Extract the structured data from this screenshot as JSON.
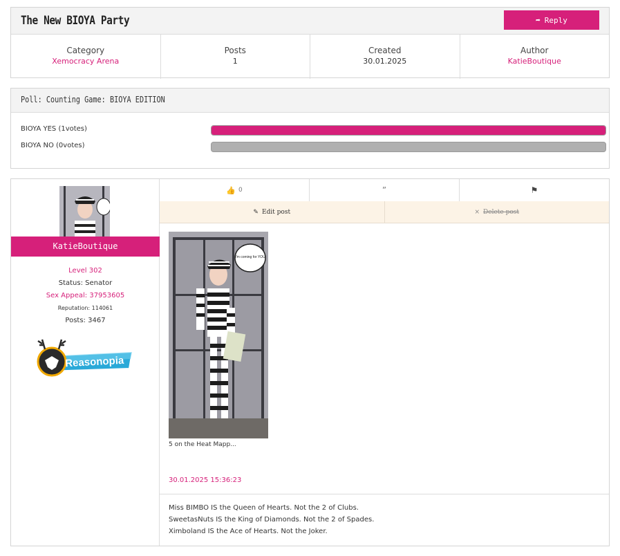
{
  "topic": {
    "title": "The New BIOYA Party",
    "reply_label": "Reply"
  },
  "meta": [
    {
      "label": "Category",
      "value": "Xemocracy Arena"
    },
    {
      "label": "Posts",
      "value": "1"
    },
    {
      "label": "Created",
      "value": "30.01.2025"
    },
    {
      "label": "Author",
      "value": "KatieBoutique"
    }
  ],
  "poll": {
    "title": "Poll: Counting Game: BIOYA EDITION",
    "options": [
      {
        "label": "BIOYA YES (1votes)",
        "fraction": 1.0
      },
      {
        "label": "BIOYA NO (0votes)",
        "fraction": 0.0
      }
    ]
  },
  "post": {
    "author": {
      "username": "KatieBoutique",
      "level": "Level 302",
      "status": "Status: Senator",
      "sex_appeal": "Sex Appeal: 37953605",
      "reputation": "Reputation: 114061",
      "posts": "Posts: 3467",
      "badge_label": "Reasonopia"
    },
    "actions": {
      "like_count": "0",
      "quote_icon": "quote-icon",
      "report_icon": "flag-icon"
    },
    "edit_label": "Edit post",
    "delete_label": "Delete post",
    "image_speech": "I'm coming for YOU",
    "caption": "5 on the Heat Mapp...",
    "timestamp": "30.01.2025 15:36:23",
    "signature": [
      "Miss BIMBO IS the Queen of Hearts.  Not the 2 of Clubs.",
      "SweetasNuts IS the King of Diamonds.  Not the 2 of Spades.",
      "Ximboland IS the Ace of Hearts.  Not the Joker."
    ]
  },
  "colors": {
    "accent": "#d6207a",
    "bar_empty": "#b0b0b0",
    "edit_bg": "#fcf3e6"
  }
}
